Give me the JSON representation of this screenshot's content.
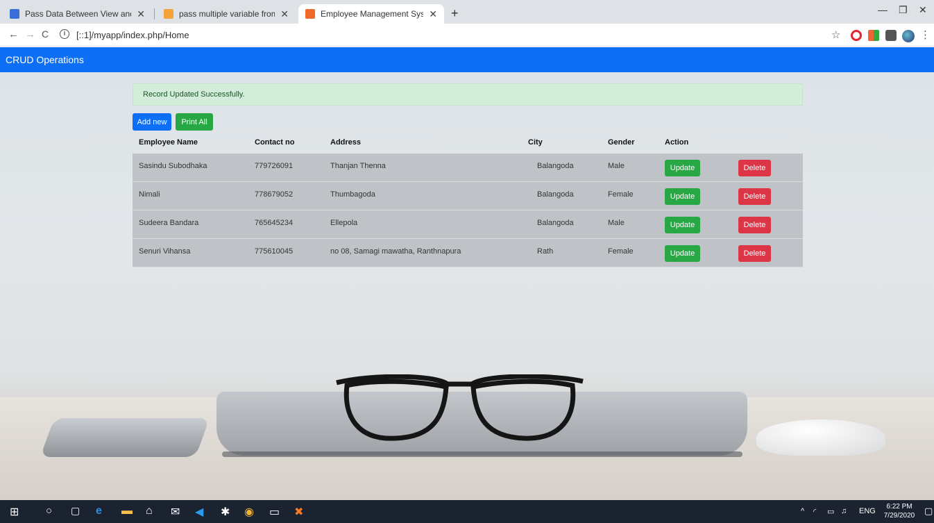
{
  "browser": {
    "tabs": [
      {
        "title": "Pass Data Between View and Con",
        "favicon_color": "#3a6fd8"
      },
      {
        "title": "pass multiple variable from contr",
        "favicon_color": "#f2a33a"
      },
      {
        "title": "Employee Management System",
        "favicon_color": "#f06a2a"
      }
    ],
    "close_glyph": "✕",
    "new_tab_glyph": "+",
    "url": "[::1]/myapp/index.php/Home",
    "window_controls": {
      "minimize": "—",
      "maximize": "❐",
      "close": "✕"
    },
    "nav": {
      "back": "←",
      "forward": "→",
      "reload": "C",
      "star": "☆",
      "menu": "⋮"
    }
  },
  "app": {
    "brand": "CRUD Operations",
    "alert": "Record Updated Successfully.",
    "add_new_label": "Add new",
    "print_all_label": "Print All",
    "table": {
      "headers": [
        "Employee Name",
        "Contact no",
        "Address",
        "City",
        "Gender",
        "Action"
      ],
      "rows": [
        {
          "name": "Sasindu Subodhaka",
          "contact": "779726091",
          "address": "Thanjan Thenna",
          "city": "Balangoda",
          "gender": "Male"
        },
        {
          "name": "Nimali",
          "contact": "778679052",
          "address": "Thumbagoda",
          "city": "Balangoda",
          "gender": "Female"
        },
        {
          "name": "Sudeera Bandara",
          "contact": "765645234",
          "address": "Ellepola",
          "city": "Balangoda",
          "gender": "Male"
        },
        {
          "name": "Senuri Vihansa",
          "contact": "775610045",
          "address": "no 08, Samagi mawatha, Ranthnapura",
          "city": "Rath",
          "gender": "Female"
        }
      ],
      "update_label": "Update",
      "delete_label": "Delete"
    }
  },
  "taskbar": {
    "language": "ENG",
    "time": "6:22 PM",
    "date": "7/29/2020"
  },
  "colors": {
    "navbar": "#0d6ff5",
    "success": "#28a745",
    "danger": "#dc3545",
    "alert_bg": "#d4edda"
  }
}
